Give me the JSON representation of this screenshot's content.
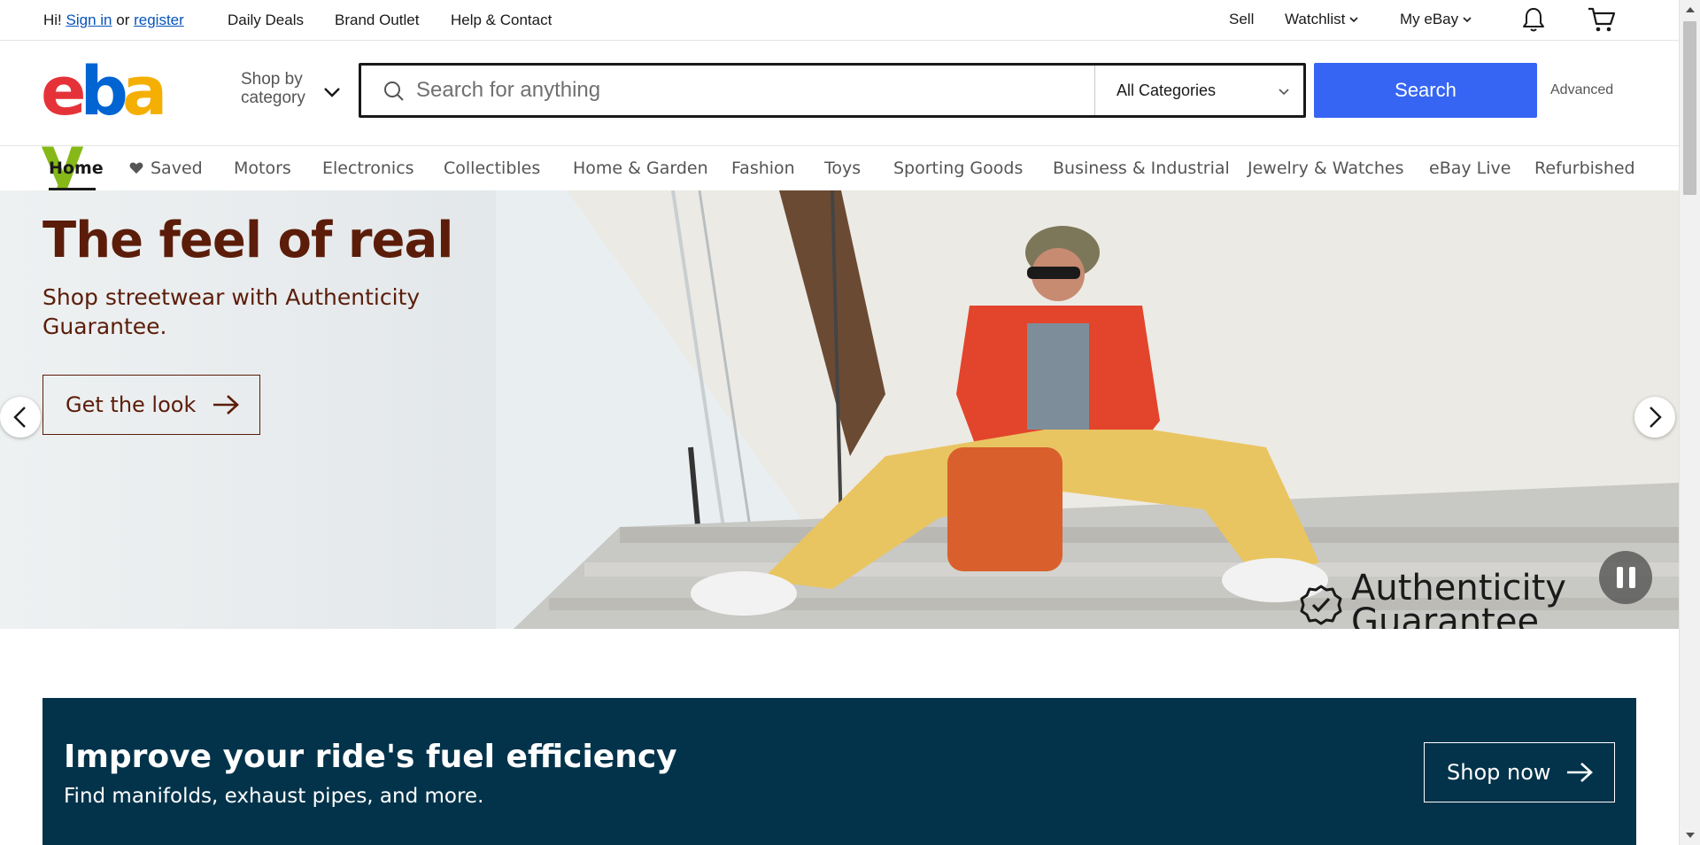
{
  "topbar": {
    "greeting": "Hi!",
    "sign_in": "Sign in",
    "or": "or",
    "register": "register",
    "daily_deals": "Daily Deals",
    "brand_outlet": "Brand Outlet",
    "help_contact": "Help & Contact",
    "sell": "Sell",
    "watchlist": "Watchlist",
    "my_ebay": "My eBay",
    "bell_icon": "bell-icon",
    "cart_icon": "cart-icon"
  },
  "header": {
    "logo_letters": [
      "e",
      "b",
      "a",
      "y"
    ],
    "logo_colors": [
      "#e53238",
      "#0064d2",
      "#f5af02",
      "#86b817"
    ],
    "shop_by_line1": "Shop by",
    "shop_by_line2": "category",
    "search_placeholder": "Search for anything",
    "search_value": "",
    "category_selected": "All Categories",
    "search_button": "Search",
    "search_button_color": "#3665f3",
    "advanced": "Advanced"
  },
  "nav": {
    "items": [
      "Home",
      "Saved",
      "Motors",
      "Electronics",
      "Collectibles",
      "Home & Garden",
      "Fashion",
      "Toys",
      "Sporting Goods",
      "Business & Industrial",
      "Jewelry & Watches",
      "eBay Live",
      "Refurbished"
    ],
    "active": "Home"
  },
  "hero": {
    "title": "The feel of real",
    "subtitle": "Shop streetwear with Authenticity Guarantee.",
    "cta": "Get the look",
    "badge_line1": "Authenticity",
    "badge_line2": "Guarantee",
    "text_color": "#5b1d0a"
  },
  "promo": {
    "title": "Improve your ride's fuel efficiency",
    "subtitle": "Find manifolds, exhaust pipes, and more.",
    "cta": "Shop now",
    "background": "#02334a"
  }
}
